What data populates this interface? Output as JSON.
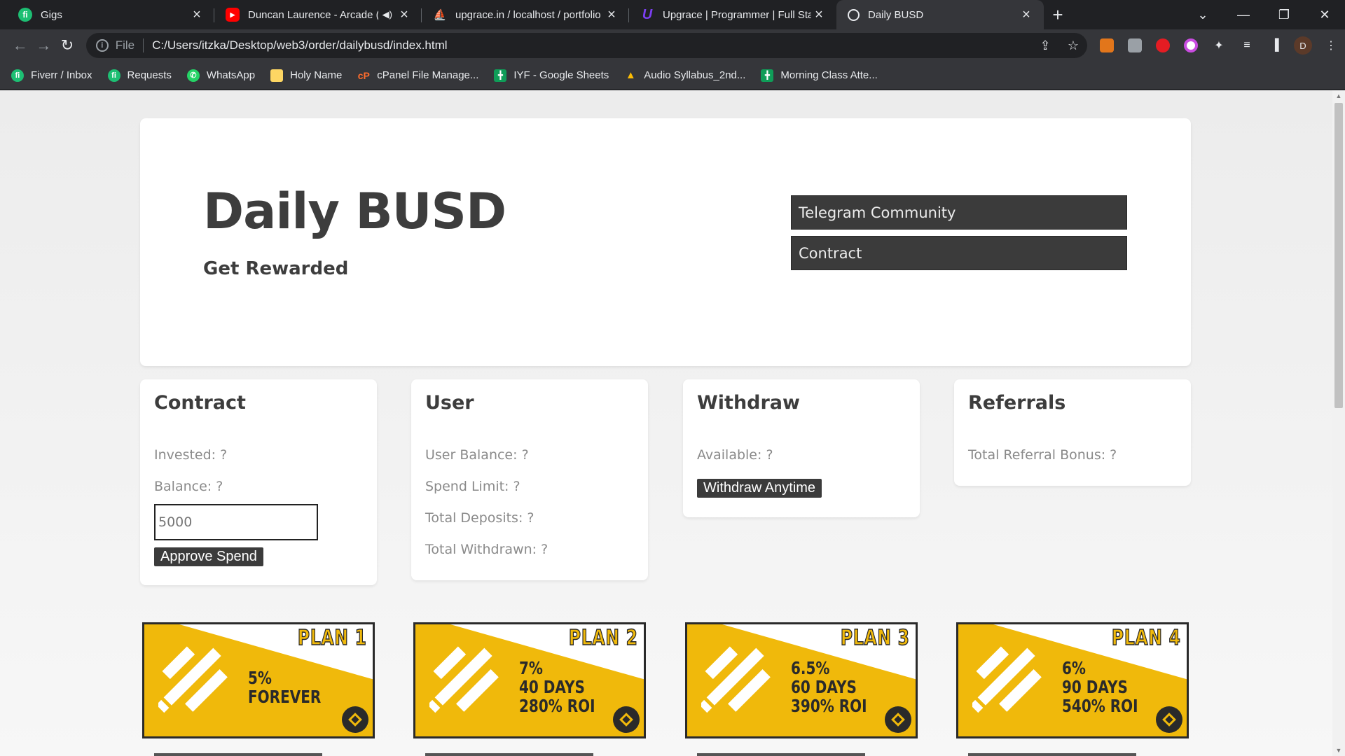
{
  "browser": {
    "tabs": [
      {
        "title": "Gigs",
        "icon": "fiverr-icon"
      },
      {
        "title": "Duncan Laurence - Arcade (L",
        "icon": "youtube-icon"
      },
      {
        "title": "upgrace.in / localhost / portfolio",
        "icon": "phpmyadmin-icon"
      },
      {
        "title": "Upgrace | Programmer | Full Stac",
        "icon": "upgrace-icon"
      },
      {
        "title": "Daily BUSD",
        "icon": "globe-icon"
      }
    ],
    "address": {
      "scheme": "File",
      "url": "C:/Users/itzka/Desktop/web3/order/dailybusd/index.html"
    },
    "avatar_letter": "D",
    "bookmarks": [
      {
        "label": "Fiverr / Inbox",
        "icon": "fiverr-icon"
      },
      {
        "label": "Requests",
        "icon": "fiverr-icon"
      },
      {
        "label": "WhatsApp",
        "icon": "whatsapp-icon"
      },
      {
        "label": "Holy Name",
        "icon": "folder-icon"
      },
      {
        "label": "cPanel File Manage...",
        "icon": "cpanel-icon"
      },
      {
        "label": "IYF - Google Sheets",
        "icon": "sheets-icon"
      },
      {
        "label": "Audio Syllabus_2nd...",
        "icon": "drive-icon"
      },
      {
        "label": "Morning Class Atte...",
        "icon": "sheets-icon"
      }
    ]
  },
  "hero": {
    "title": "Daily BUSD",
    "subtitle": "Get Rewarded",
    "telegram_label": "Telegram Community",
    "contract_label": "Contract"
  },
  "contract": {
    "heading": "Contract",
    "invested": "Invested: ?",
    "balance": "Balance: ?",
    "amount_placeholder": "5000",
    "approve_label": "Approve Spend"
  },
  "user": {
    "heading": "User",
    "user_balance": "User Balance: ?",
    "spend_limit": "Spend Limit: ?",
    "total_deposits": "Total Deposits: ?",
    "total_withdrawn": "Total Withdrawn: ?"
  },
  "withdraw": {
    "heading": "Withdraw",
    "available": "Available: ?",
    "button_label": "Withdraw Anytime"
  },
  "referrals": {
    "heading": "Referrals",
    "total_bonus": "Total Referral Bonus: ?"
  },
  "plans": [
    {
      "title": "PLAN 1",
      "lines": [
        "5%",
        "FOREVER"
      ]
    },
    {
      "title": "PLAN 2",
      "lines": [
        "7%",
        "40 DAYS",
        "280% ROI"
      ]
    },
    {
      "title": "PLAN 3",
      "lines": [
        "6.5%",
        "60 DAYS",
        "390% ROI"
      ]
    },
    {
      "title": "PLAN 4",
      "lines": [
        "6%",
        "90 DAYS",
        "540% ROI"
      ]
    }
  ],
  "colors": {
    "plan_yellow": "#f0b90b",
    "button_dark": "#3b3b3b",
    "text_dark": "#3d3d3d"
  }
}
